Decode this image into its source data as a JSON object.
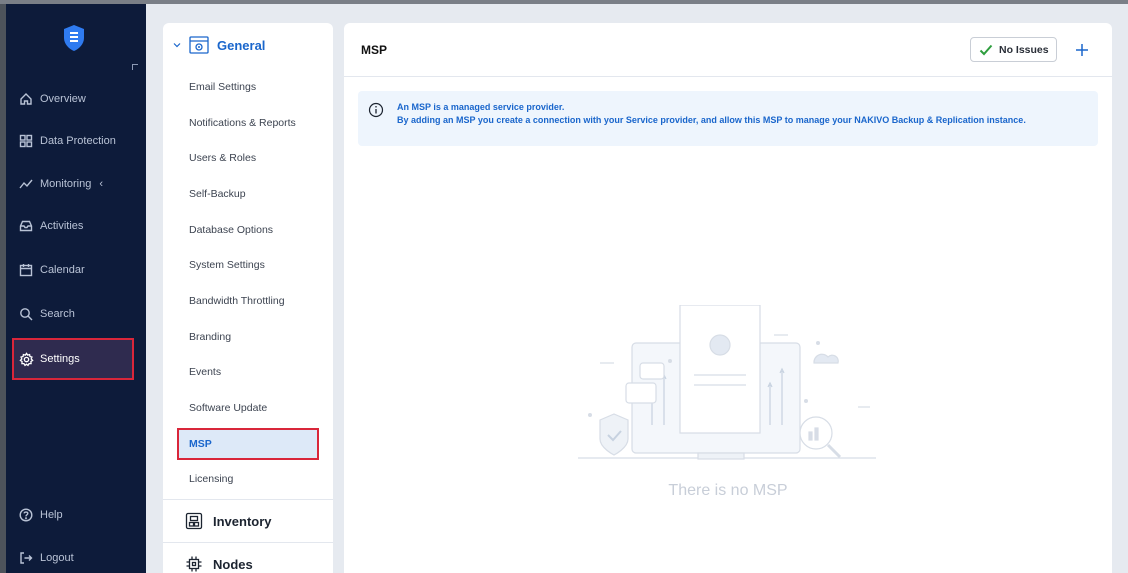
{
  "sidebar": {
    "items": [
      {
        "label": "Overview",
        "icon": "home-icon"
      },
      {
        "label": "Data Protection",
        "icon": "grid-icon"
      },
      {
        "label": "Monitoring",
        "icon": "monitoring-icon",
        "suffix": "‹"
      },
      {
        "label": "Activities",
        "icon": "inbox-icon"
      },
      {
        "label": "Calendar",
        "icon": "calendar-icon"
      },
      {
        "label": "Search",
        "icon": "search-icon"
      },
      {
        "label": "Settings",
        "icon": "gear-icon",
        "active": true
      }
    ],
    "bottom": [
      {
        "label": "Help",
        "icon": "help-icon"
      },
      {
        "label": "Logout",
        "icon": "logout-icon"
      }
    ]
  },
  "submenu": {
    "header": "General",
    "items": [
      "Email Settings",
      "Notifications & Reports",
      "Users & Roles",
      "Self-Backup",
      "Database Options",
      "System Settings",
      "Bandwidth Throttling",
      "Branding",
      "Events",
      "Software Update",
      "MSP",
      "Licensing"
    ],
    "active_item": "MSP",
    "sections": [
      "Inventory",
      "Nodes"
    ]
  },
  "main": {
    "title": "MSP",
    "status_label": "No Issues",
    "info_line1": "An MSP is a managed service provider.",
    "info_line2": "By adding an MSP you create a connection with your Service provider, and allow this MSP to manage your NAKIVO Backup & Replication instance.",
    "empty_text": "There is no MSP"
  },
  "colors": {
    "sidebar_bg": "#0d1b3a",
    "accent": "#1a66cc",
    "highlight_border": "#d9263a",
    "ok_green": "#2e9e3e"
  }
}
